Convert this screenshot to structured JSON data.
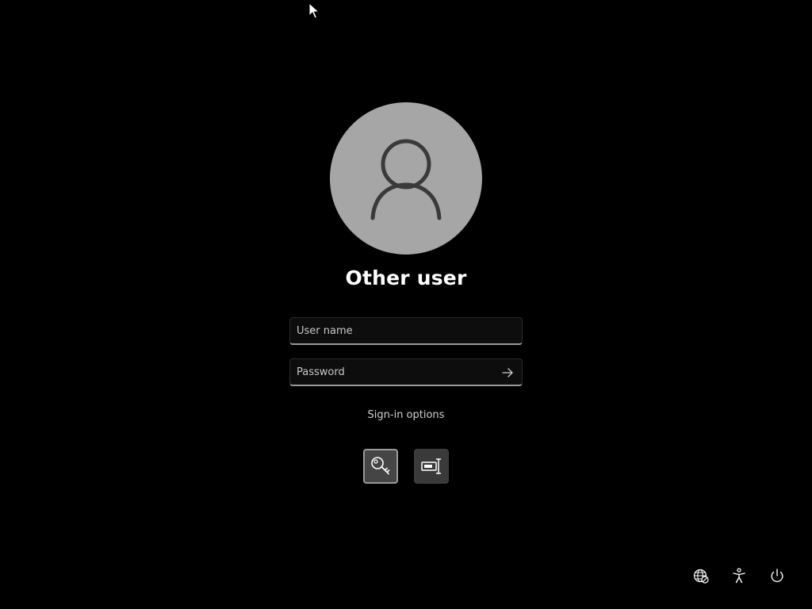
{
  "user": {
    "display_name": "Other user"
  },
  "fields": {
    "username_placeholder": "User name",
    "username_value": "",
    "password_placeholder": "Password",
    "password_value": ""
  },
  "signin": {
    "options_label": "Sign-in options",
    "methods": [
      {
        "icon": "key-icon",
        "name": "Password",
        "selected": true
      },
      {
        "icon": "smart-card-icon",
        "name": "Smart card",
        "selected": false
      }
    ]
  },
  "system_icons": {
    "network": "network-icon",
    "accessibility": "accessibility-icon",
    "power": "power-icon"
  },
  "colors": {
    "background": "#000000",
    "avatar": "#a6a6a6",
    "avatar_glyph": "#3a3a3a",
    "field_bg": "#0d0d0d",
    "field_underline": "#9a9a9a"
  }
}
